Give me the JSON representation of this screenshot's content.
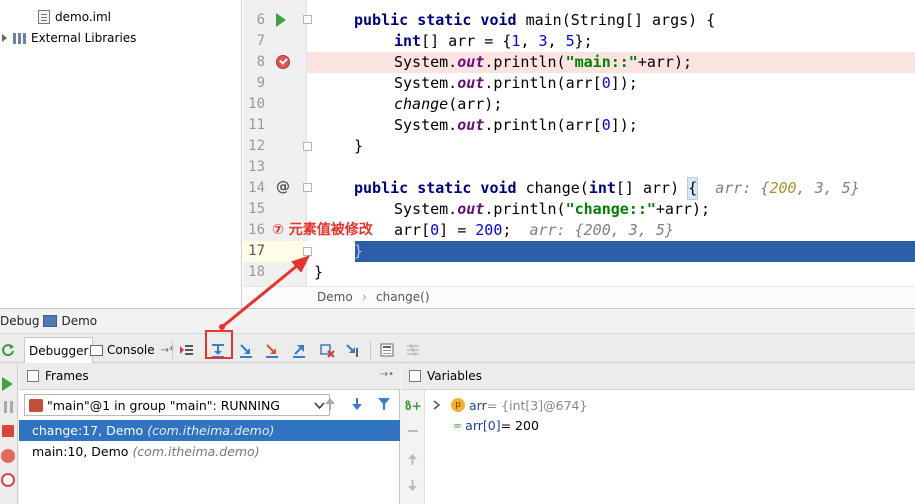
{
  "project": {
    "items": [
      {
        "label": "demo.iml",
        "icon": "file-icon"
      },
      {
        "label": "External Libraries",
        "icon": "library-icon"
      }
    ]
  },
  "editor": {
    "line_numbers": [
      "6",
      "7",
      "8",
      "9",
      "10",
      "11",
      "12",
      "13",
      "14",
      "15",
      "16",
      "17",
      "18"
    ],
    "lines": {
      "l6": {
        "kw1": "public static void",
        "plain": " main(String[] args) {"
      },
      "l7": {
        "kw1": "int",
        "plain1": "[] arr = {",
        "n1": "1",
        "p2": ", ",
        "n2": "3",
        "p3": ", ",
        "n3": "5",
        "p4": "};"
      },
      "l8": {
        "p1": "System.",
        "fld": "out",
        "p2": ".println(",
        "str": "\"main::\"",
        "p3": "+arr);"
      },
      "l9": {
        "p1": "System.",
        "fld": "out",
        "p2": ".println(arr[",
        "n1": "0",
        "p3": "]);"
      },
      "l10": {
        "it": "change",
        "p1": "(arr);"
      },
      "l11": {
        "p1": "System.",
        "fld": "out",
        "p2": ".println(arr[",
        "n1": "0",
        "p3": "]);"
      },
      "l12": {
        "p1": "}"
      },
      "l14": {
        "kw1": "public static void",
        "p1": " change(",
        "kw2": "int",
        "p2": "[] arr) ",
        "brace": "{",
        "hint": "  arr: {",
        "h1": "200",
        "h2": ", 3, 5}"
      },
      "l15": {
        "p1": "System.",
        "fld": "out",
        "p2": ".println(",
        "str": "\"change::\"",
        "p3": "+arr);"
      },
      "l16": {
        "p1": "arr[",
        "n1": "0",
        "p2": "] = ",
        "n2": "200",
        "p3": ";",
        "hint": "  arr: {200, 3, 5}"
      },
      "l17": {
        "p1": "}"
      },
      "l18": {
        "p1": "}"
      }
    },
    "breadcrumb": {
      "class_name": "Demo",
      "separator": "›",
      "method": "change()"
    }
  },
  "annotation": {
    "text": "⑦ 元素值被修改",
    "color": "#e8322c"
  },
  "debug": {
    "title": "Debug",
    "config": "Demo",
    "tabs": {
      "debugger": "Debugger",
      "console": "Console",
      "console_suffix": "→*"
    },
    "frames": {
      "title": "Frames",
      "thread": "\"main\"@1 in group \"main\": RUNNING",
      "rows": [
        {
          "method": "change:17, Demo",
          "pkg": "(com.itheima.demo)"
        },
        {
          "method": "main:10, Demo",
          "pkg": "(com.itheima.demo)"
        }
      ]
    },
    "variables": {
      "title": "Variables",
      "rows": [
        {
          "badge": "p",
          "name": "arr",
          "value": " = {int[3]@674}"
        },
        {
          "name": "arr[0]",
          "value": " = 200"
        }
      ]
    }
  },
  "colors": {
    "execution_line": "#2c5ea9",
    "selected_frame": "#2f73c1",
    "breakpoint_line": "#fae3e0",
    "keyword": "#000080",
    "number": "#0000ff",
    "string": "#008000",
    "field": "#660e7a"
  }
}
